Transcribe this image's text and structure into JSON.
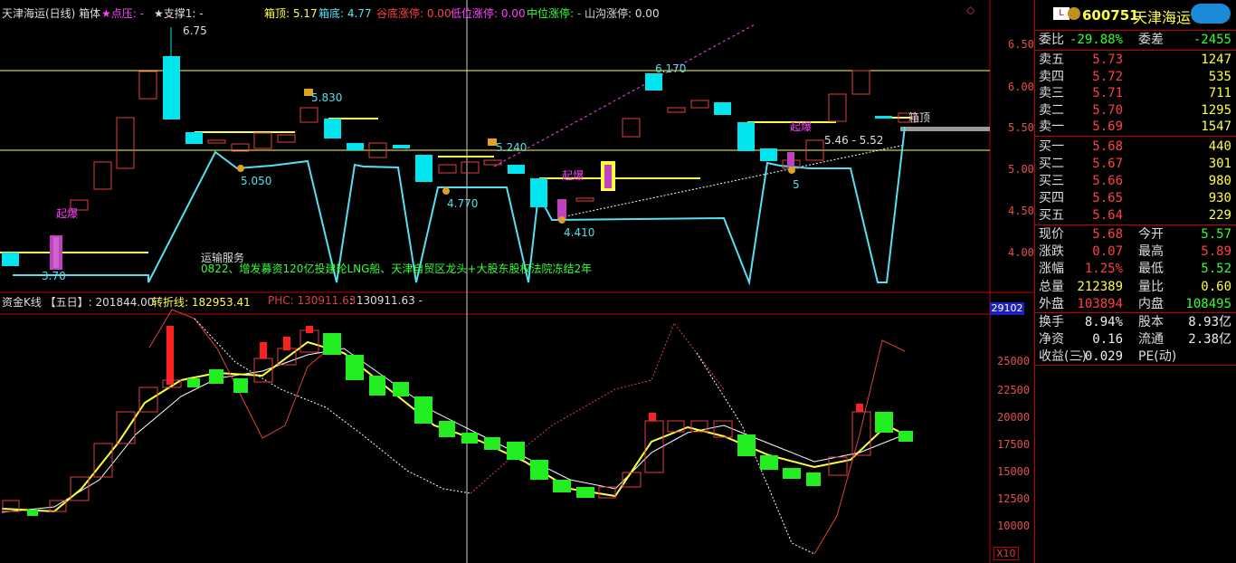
{
  "header": {
    "title": "天津海运(日线) 箱体",
    "point_label": "★点压: -",
    "support_label": "★支撑1: -",
    "box_top": "箱顶: 5.17",
    "box_bottom": "箱底: 4.77",
    "valley_label": "谷底涨停: 0.00",
    "low_label": "低位涨停: 0.00",
    "mid_label": "中位涨停: -",
    "ditch_label": "山沟涨停: 0.00"
  },
  "sub_header": {
    "title": "资金K线 【五日】: 201844.00",
    "turn_label": "转折线: 182953.41",
    "phc_label": "PHC: 130911.63",
    "phc_value": ": 130911.63  -"
  },
  "price_axis": [
    "6.50",
    "6.00",
    "5.50",
    "5.00",
    "4.50",
    "4.00"
  ],
  "sub_axis": [
    "25000",
    "22500",
    "20000",
    "17500",
    "15000",
    "12500",
    "10000"
  ],
  "sub_axis_badge": "29102",
  "sub_axis_x10": "X10",
  "annotations": {
    "high": "6.75",
    "p5830": "5.830",
    "p6170": "6.170",
    "p5240": "5.240",
    "p5050": "5.050",
    "p4770": "4.770",
    "p4410": "4.410",
    "p370": "3.70",
    "p5": "5",
    "range": "5.46 - 5.52",
    "box_top_tag": "箱顶",
    "burst1": "起爆",
    "burst2": "起爆",
    "burst3": "起爆",
    "news_title": "运输服务",
    "news_text": "0822、增发募资120亿投建轮LNG船、天津自贸区龙头+大股东股权法院冻结2年"
  },
  "quote": {
    "code": "600751",
    "name": "天津海运",
    "weibi_label": "委比",
    "weibi": "-29.88%",
    "weicha_label": "委差",
    "weicha": "-2455",
    "sell": [
      {
        "label": "卖五",
        "price": "5.73",
        "vol": "1247"
      },
      {
        "label": "卖四",
        "price": "5.72",
        "vol": "535"
      },
      {
        "label": "卖三",
        "price": "5.71",
        "vol": "711"
      },
      {
        "label": "卖二",
        "price": "5.70",
        "vol": "1295"
      },
      {
        "label": "卖一",
        "price": "5.69",
        "vol": "1547"
      }
    ],
    "buy": [
      {
        "label": "买一",
        "price": "5.68",
        "vol": "440"
      },
      {
        "label": "买二",
        "price": "5.67",
        "vol": "301"
      },
      {
        "label": "买三",
        "price": "5.66",
        "vol": "980"
      },
      {
        "label": "买四",
        "price": "5.65",
        "vol": "930"
      },
      {
        "label": "买五",
        "price": "5.64",
        "vol": "229"
      }
    ],
    "stats": [
      {
        "l1": "现价",
        "v1": "5.68",
        "c1": "red",
        "l2": "今开",
        "v2": "5.57",
        "c2": "green"
      },
      {
        "l1": "涨跌",
        "v1": "0.07",
        "c1": "red",
        "l2": "最高",
        "v2": "5.89",
        "c2": "red"
      },
      {
        "l1": "涨幅",
        "v1": "1.25%",
        "c1": "red",
        "l2": "最低",
        "v2": "5.52",
        "c2": "green"
      },
      {
        "l1": "总量",
        "v1": "212389",
        "c1": "yellow",
        "l2": "量比",
        "v2": "0.60",
        "c2": "yellow"
      },
      {
        "l1": "外盘",
        "v1": "103894",
        "c1": "red",
        "l2": "内盘",
        "v2": "108495",
        "c2": "green"
      }
    ],
    "stats2": [
      {
        "l1": "换手",
        "v1": "8.94%",
        "l2": "股本",
        "v2": "8.93亿"
      },
      {
        "l1": "净资",
        "v1": "0.16",
        "l2": "流通",
        "v2": "2.38亿"
      },
      {
        "l1": "收益(三)",
        "v1": "-0.029",
        "l2": "PE(动)",
        "v2": ""
      }
    ]
  },
  "colors": {
    "up": "#ff3030",
    "down": "#00e5ee",
    "box": "#ffff40",
    "line": "#55e0f0"
  }
}
